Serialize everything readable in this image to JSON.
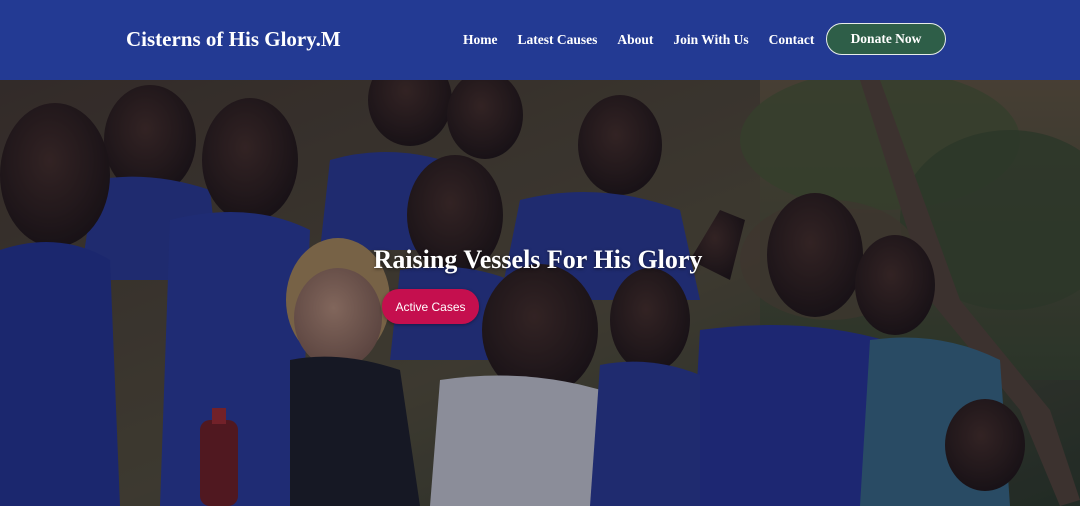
{
  "brand": {
    "name": "Cisterns of His Glory.M"
  },
  "nav": {
    "items": [
      {
        "label": "Home"
      },
      {
        "label": "Latest Causes"
      },
      {
        "label": "About"
      },
      {
        "label": "Join With Us"
      },
      {
        "label": "Contact"
      }
    ],
    "donate_label": "Donate Now"
  },
  "hero": {
    "title": "Raising Vessels For His Glory",
    "button_label": "Active Cases",
    "image_subject": "group-of-smiling-schoolchildren-photo"
  },
  "colors": {
    "navbar_bg": "#233a93",
    "donate_bg": "#2e5e48",
    "active_button_bg": "#c50f4e",
    "uniform_blue": "#2a3a9c"
  }
}
